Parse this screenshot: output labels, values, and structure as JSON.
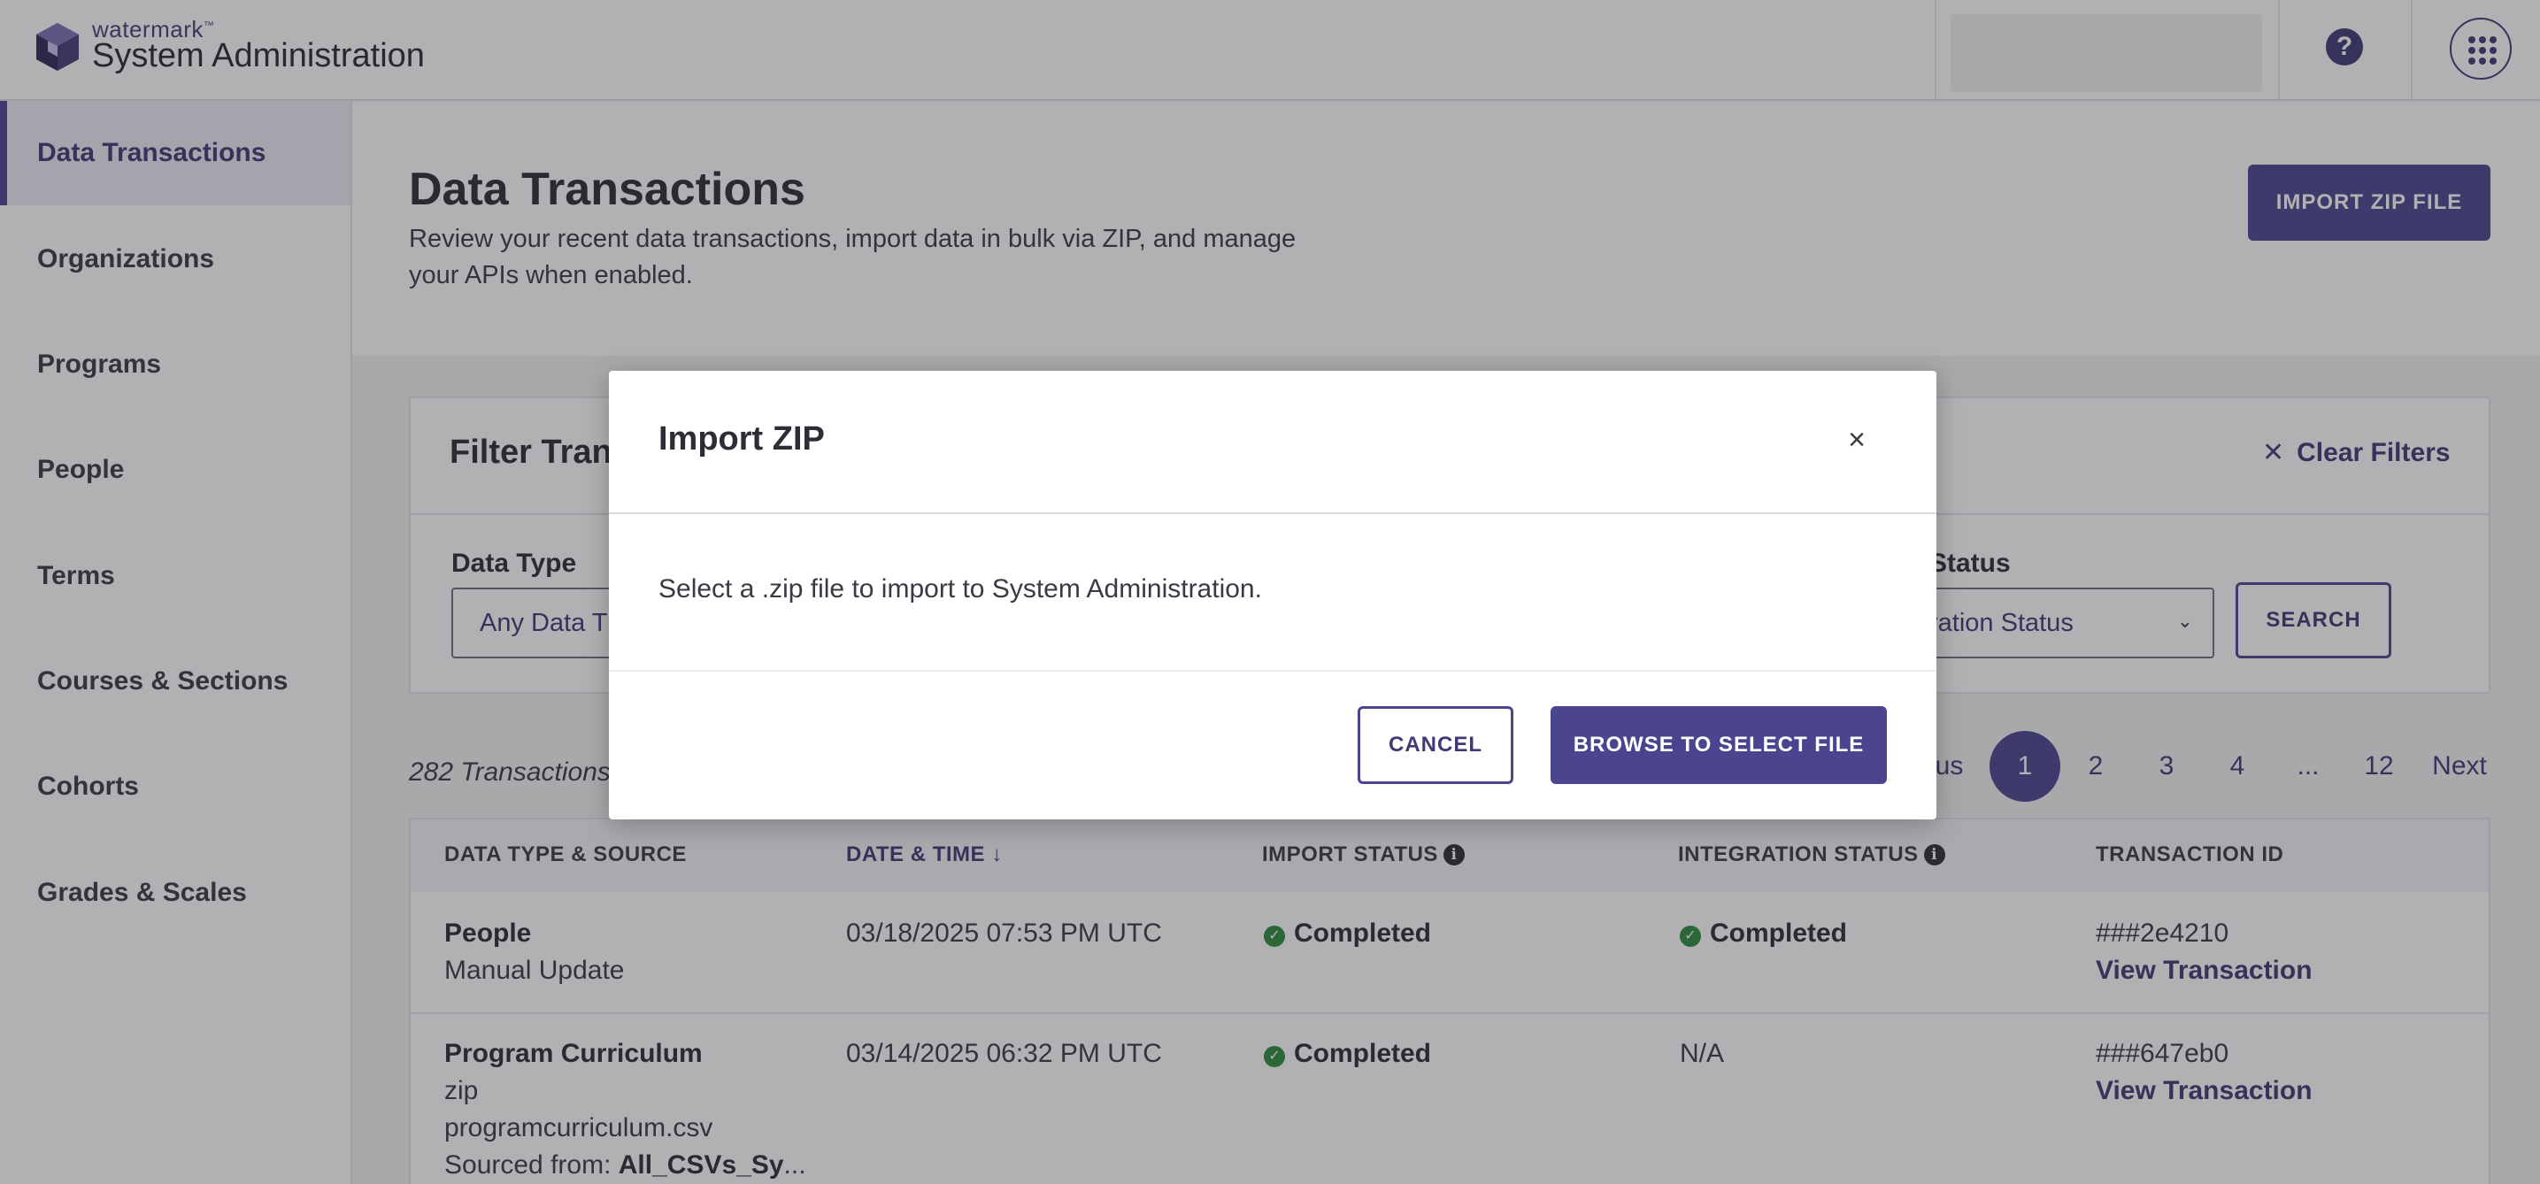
{
  "brand": {
    "small": "watermark",
    "tm": "™",
    "title": "System Administration"
  },
  "sidebar": {
    "items": [
      {
        "label": "Data Transactions",
        "active": true
      },
      {
        "label": "Organizations"
      },
      {
        "label": "Programs"
      },
      {
        "label": "People"
      },
      {
        "label": "Terms"
      },
      {
        "label": "Courses & Sections"
      },
      {
        "label": "Cohorts"
      },
      {
        "label": "Grades & Scales"
      }
    ]
  },
  "header": {
    "title": "Data Transactions",
    "description": "Review your recent data transactions, import data in bulk via ZIP, and manage your APIs when enabled.",
    "import_button": "IMPORT ZIP FILE",
    "help_icon": "?"
  },
  "filters": {
    "title": "Filter Tran",
    "clear_label": "Clear Filters",
    "data_type_label": "Data Type",
    "data_type_value": "Any Data T",
    "status_label": "Status",
    "status_value": "ration Status",
    "search_button": "SEARCH"
  },
  "results": {
    "count_text": "282 Transactions",
    "pagination": {
      "previous": "ous",
      "pages": [
        "1",
        "2",
        "3",
        "4",
        "...",
        "12"
      ],
      "current": "1",
      "next": "Next"
    }
  },
  "table": {
    "columns": [
      "DATA TYPE & SOURCE",
      "DATE & TIME",
      "IMPORT STATUS",
      "INTEGRATION STATUS",
      "TRANSACTION ID"
    ],
    "sort_arrow": "↓",
    "rows": [
      {
        "type": "People",
        "source": [
          "Manual Update"
        ],
        "datetime": "03/18/2025 07:53 PM UTC",
        "import_status": "Completed",
        "integration_status": "Completed",
        "tx_id": "###2e4210",
        "link": "View Transaction"
      },
      {
        "type": "Program Curriculum",
        "source": [
          "zip",
          "programcurriculum.csv"
        ],
        "sourced_prefix": "Sourced from: ",
        "sourced_value": "All_CSVs_Sy",
        "ellipsis": "...",
        "datetime": "03/14/2025 06:32 PM UTC",
        "import_status": "Completed",
        "integration_status": "N/A",
        "tx_id": "###647eb0",
        "link": "View Transaction"
      }
    ]
  },
  "modal": {
    "title": "Import ZIP",
    "body": "Select a .zip file to import to System Administration.",
    "cancel": "CANCEL",
    "browse": "BROWSE TO SELECT FILE",
    "close_glyph": "×"
  },
  "colors": {
    "brand": "#4b4590",
    "success": "#2e8b3e"
  }
}
